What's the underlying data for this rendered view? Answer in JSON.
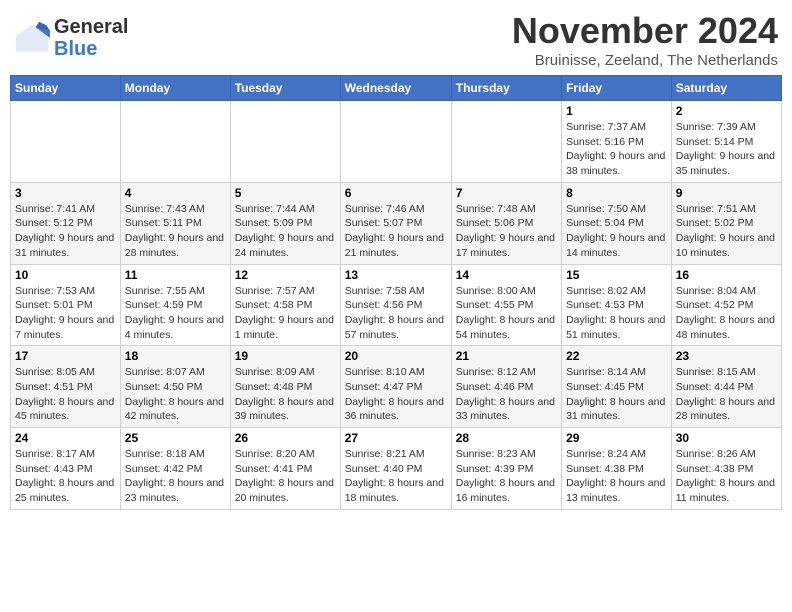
{
  "logo": {
    "general": "General",
    "blue": "Blue"
  },
  "title": "November 2024",
  "location": "Bruinisse, Zeeland, The Netherlands",
  "headers": [
    "Sunday",
    "Monday",
    "Tuesday",
    "Wednesday",
    "Thursday",
    "Friday",
    "Saturday"
  ],
  "weeks": [
    [
      {
        "day": "",
        "info": ""
      },
      {
        "day": "",
        "info": ""
      },
      {
        "day": "",
        "info": ""
      },
      {
        "day": "",
        "info": ""
      },
      {
        "day": "",
        "info": ""
      },
      {
        "day": "1",
        "info": "Sunrise: 7:37 AM\nSunset: 5:16 PM\nDaylight: 9 hours and 38 minutes."
      },
      {
        "day": "2",
        "info": "Sunrise: 7:39 AM\nSunset: 5:14 PM\nDaylight: 9 hours and 35 minutes."
      }
    ],
    [
      {
        "day": "3",
        "info": "Sunrise: 7:41 AM\nSunset: 5:12 PM\nDaylight: 9 hours and 31 minutes."
      },
      {
        "day": "4",
        "info": "Sunrise: 7:43 AM\nSunset: 5:11 PM\nDaylight: 9 hours and 28 minutes."
      },
      {
        "day": "5",
        "info": "Sunrise: 7:44 AM\nSunset: 5:09 PM\nDaylight: 9 hours and 24 minutes."
      },
      {
        "day": "6",
        "info": "Sunrise: 7:46 AM\nSunset: 5:07 PM\nDaylight: 9 hours and 21 minutes."
      },
      {
        "day": "7",
        "info": "Sunrise: 7:48 AM\nSunset: 5:06 PM\nDaylight: 9 hours and 17 minutes."
      },
      {
        "day": "8",
        "info": "Sunrise: 7:50 AM\nSunset: 5:04 PM\nDaylight: 9 hours and 14 minutes."
      },
      {
        "day": "9",
        "info": "Sunrise: 7:51 AM\nSunset: 5:02 PM\nDaylight: 9 hours and 10 minutes."
      }
    ],
    [
      {
        "day": "10",
        "info": "Sunrise: 7:53 AM\nSunset: 5:01 PM\nDaylight: 9 hours and 7 minutes."
      },
      {
        "day": "11",
        "info": "Sunrise: 7:55 AM\nSunset: 4:59 PM\nDaylight: 9 hours and 4 minutes."
      },
      {
        "day": "12",
        "info": "Sunrise: 7:57 AM\nSunset: 4:58 PM\nDaylight: 9 hours and 1 minute."
      },
      {
        "day": "13",
        "info": "Sunrise: 7:58 AM\nSunset: 4:56 PM\nDaylight: 8 hours and 57 minutes."
      },
      {
        "day": "14",
        "info": "Sunrise: 8:00 AM\nSunset: 4:55 PM\nDaylight: 8 hours and 54 minutes."
      },
      {
        "day": "15",
        "info": "Sunrise: 8:02 AM\nSunset: 4:53 PM\nDaylight: 8 hours and 51 minutes."
      },
      {
        "day": "16",
        "info": "Sunrise: 8:04 AM\nSunset: 4:52 PM\nDaylight: 8 hours and 48 minutes."
      }
    ],
    [
      {
        "day": "17",
        "info": "Sunrise: 8:05 AM\nSunset: 4:51 PM\nDaylight: 8 hours and 45 minutes."
      },
      {
        "day": "18",
        "info": "Sunrise: 8:07 AM\nSunset: 4:50 PM\nDaylight: 8 hours and 42 minutes."
      },
      {
        "day": "19",
        "info": "Sunrise: 8:09 AM\nSunset: 4:48 PM\nDaylight: 8 hours and 39 minutes."
      },
      {
        "day": "20",
        "info": "Sunrise: 8:10 AM\nSunset: 4:47 PM\nDaylight: 8 hours and 36 minutes."
      },
      {
        "day": "21",
        "info": "Sunrise: 8:12 AM\nSunset: 4:46 PM\nDaylight: 8 hours and 33 minutes."
      },
      {
        "day": "22",
        "info": "Sunrise: 8:14 AM\nSunset: 4:45 PM\nDaylight: 8 hours and 31 minutes."
      },
      {
        "day": "23",
        "info": "Sunrise: 8:15 AM\nSunset: 4:44 PM\nDaylight: 8 hours and 28 minutes."
      }
    ],
    [
      {
        "day": "24",
        "info": "Sunrise: 8:17 AM\nSunset: 4:43 PM\nDaylight: 8 hours and 25 minutes."
      },
      {
        "day": "25",
        "info": "Sunrise: 8:18 AM\nSunset: 4:42 PM\nDaylight: 8 hours and 23 minutes."
      },
      {
        "day": "26",
        "info": "Sunrise: 8:20 AM\nSunset: 4:41 PM\nDaylight: 8 hours and 20 minutes."
      },
      {
        "day": "27",
        "info": "Sunrise: 8:21 AM\nSunset: 4:40 PM\nDaylight: 8 hours and 18 minutes."
      },
      {
        "day": "28",
        "info": "Sunrise: 8:23 AM\nSunset: 4:39 PM\nDaylight: 8 hours and 16 minutes."
      },
      {
        "day": "29",
        "info": "Sunrise: 8:24 AM\nSunset: 4:38 PM\nDaylight: 8 hours and 13 minutes."
      },
      {
        "day": "30",
        "info": "Sunrise: 8:26 AM\nSunset: 4:38 PM\nDaylight: 8 hours and 11 minutes."
      }
    ]
  ]
}
